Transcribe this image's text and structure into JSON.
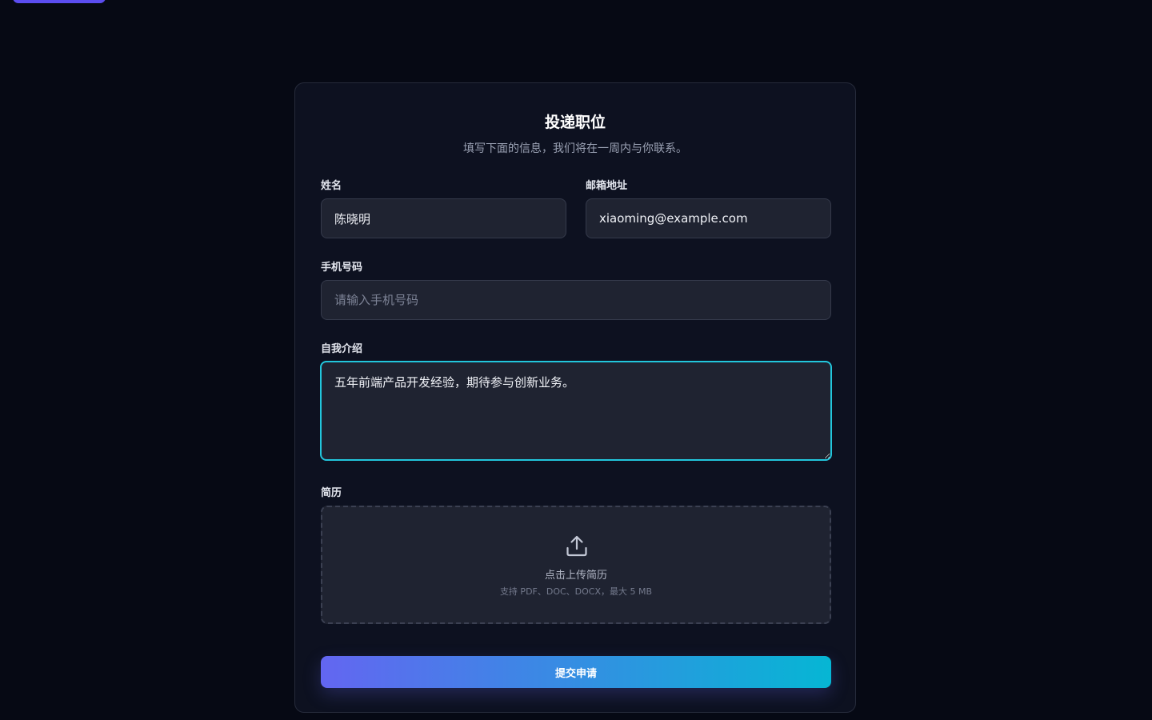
{
  "form": {
    "title": "投递职位",
    "subtitle": "填写下面的信息，我们将在一周内与你联系。",
    "name_label": "姓名",
    "name_value": "陈晓明",
    "email_label": "邮箱地址",
    "email_value": "xiaoming@example.com",
    "phone_label": "手机号码",
    "phone_placeholder": "请输入手机号码",
    "intro_label": "自我介绍",
    "intro_value": "五年前端产品开发经验，期待参与创新业务。",
    "resume_label": "简历",
    "upload_title": "点击上传简历",
    "upload_hint": "支持 PDF、DOC、DOCX，最大 5 MB",
    "submit_label": "提交申请"
  },
  "icons": {
    "upload": "upload-icon"
  },
  "colors": {
    "background": "#060914",
    "card": "#0d1120",
    "input": "#1f2331",
    "focus_border": "#22c6dc",
    "gradient_start": "#6366f1",
    "gradient_end": "#06b6d4"
  }
}
